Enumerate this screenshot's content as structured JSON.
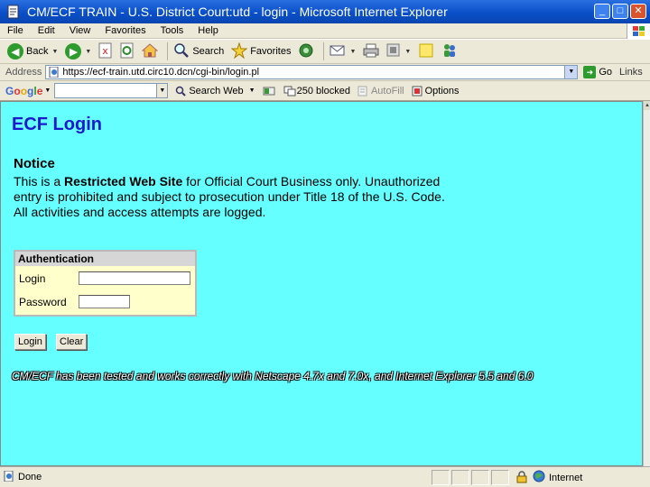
{
  "window": {
    "title": "CM/ECF TRAIN - U.S. District Court:utd - login - Microsoft Internet Explorer"
  },
  "menu": [
    "File",
    "Edit",
    "View",
    "Favorites",
    "Tools",
    "Help"
  ],
  "toolbar": {
    "back": "Back",
    "search": "Search",
    "favorites": "Favorites"
  },
  "address": {
    "label": "Address",
    "url": "https://ecf-train.utd.circ10.dcn/cgi-bin/login.pl",
    "go": "Go",
    "links": "Links"
  },
  "google_bar": {
    "logo": "Google",
    "search_web": "Search Web",
    "blocked": "250 blocked",
    "autofill": "AutoFill",
    "options": "Options"
  },
  "page": {
    "heading": "ECF Login",
    "notice_title": "Notice",
    "notice_prefix": "This is a ",
    "notice_bold": "Restricted Web Site",
    "notice_rest": " for Official Court Business only. Unauthorized entry is prohibited and subject to prosecution under Title 18 of the U.S. Code. All activities and access attempts are logged.",
    "auth": {
      "header": "Authentication",
      "login_label": "Login",
      "login_value": "",
      "password_label": "Password",
      "password_value": ""
    },
    "buttons": {
      "login": "Login",
      "clear": "Clear"
    },
    "compat_note": "CM/ECF has been tested and works correctly with Netscape 4.7x and 7.0x, and Internet Explorer 5.5 and 6.0"
  },
  "status": {
    "text": "Done",
    "zone": "Internet"
  },
  "colors": {
    "page_bg": "#66ffff",
    "heading": "#1a1acc",
    "auth_bg": "#ffffcc",
    "titlebar": "#0a4fc8"
  }
}
